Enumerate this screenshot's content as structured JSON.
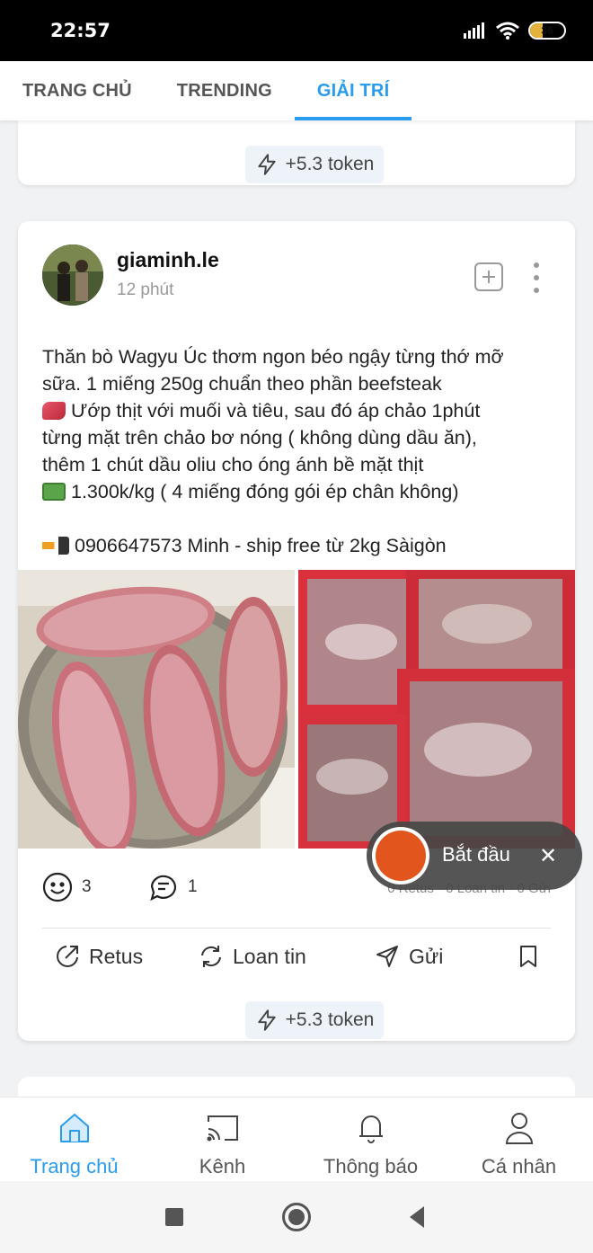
{
  "status_bar": {
    "time": "22:57",
    "battery": "36",
    "battery_level": 0.36
  },
  "top_tabs": [
    {
      "label": "TRANG CHỦ",
      "active": false
    },
    {
      "label": "TRENDING",
      "active": false
    },
    {
      "label": "GIẢI TRÍ",
      "active": true
    }
  ],
  "top_card": {
    "token": "+5.3 token"
  },
  "post": {
    "username": "giaminh.le",
    "time": "12 phút",
    "lines": [
      "Thăn bò Wagyu Úc thơm ngon béo ngậy từng thớ mỡ",
      "sữa. 1 miếng 250g chuẩn theo phần beefsteak",
      "Ướp thịt với muối và tiêu, sau đó áp chảo 1phút",
      "từng mặt trên chảo bơ nóng ( không dùng dầu ăn),",
      "thêm 1 chút dầu oliu cho óng ánh bề mặt thịt",
      "1.300k/kg ( 4 miếng đóng gói ép chân không)",
      "",
      "0906647573 Minh - ship free từ 2kg Sàigòn"
    ],
    "reactions": "3",
    "comments": "1",
    "share_stats": "0 Retus · 0 Loan tin · 0 Gửi",
    "actions": {
      "retus": "Retus",
      "repost": "Loan tin",
      "send": "Gửi"
    },
    "token": "+5.3 token"
  },
  "record_widget": {
    "label": "Bắt đầu",
    "close": "✕"
  },
  "bottom_nav": [
    {
      "label": "Trang chủ",
      "icon": "home-icon",
      "active": true
    },
    {
      "label": "Kênh",
      "icon": "cast-icon",
      "active": false
    },
    {
      "label": "Thông báo",
      "icon": "bell-icon",
      "active": false
    },
    {
      "label": "Cá nhân",
      "icon": "user-icon",
      "active": false
    }
  ],
  "colors": {
    "accent": "#2a9cf0",
    "record": "#e2561e"
  }
}
